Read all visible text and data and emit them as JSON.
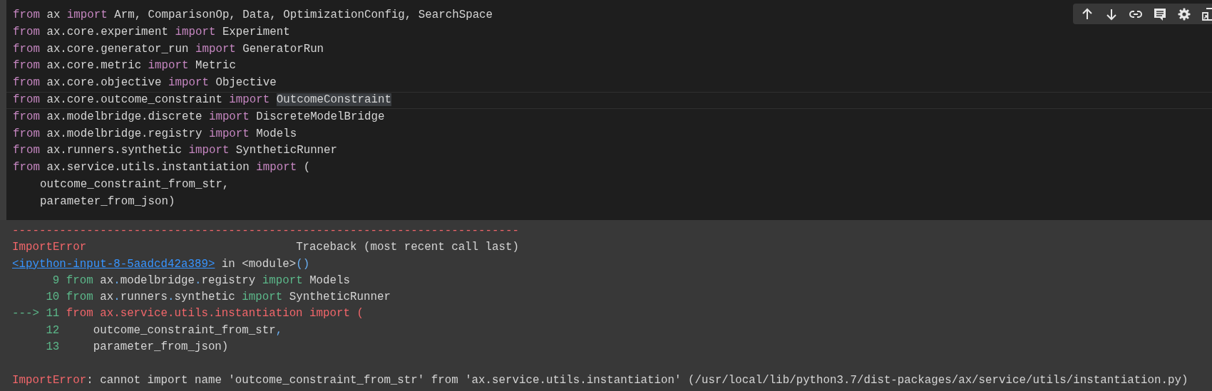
{
  "code_cell": {
    "lines": [
      {
        "current": false,
        "tokens": [
          {
            "kind": "kw",
            "text": "from"
          },
          {
            "kind": "plain",
            "text": " ax "
          },
          {
            "kind": "kw",
            "text": "import"
          },
          {
            "kind": "plain",
            "text": " Arm, ComparisonOp, Data, OptimizationConfig, SearchSpace"
          }
        ]
      },
      {
        "current": false,
        "tokens": [
          {
            "kind": "kw",
            "text": "from"
          },
          {
            "kind": "plain",
            "text": " ax.core.experiment "
          },
          {
            "kind": "kw",
            "text": "import"
          },
          {
            "kind": "plain",
            "text": " Experiment"
          }
        ]
      },
      {
        "current": false,
        "tokens": [
          {
            "kind": "kw",
            "text": "from"
          },
          {
            "kind": "plain",
            "text": " ax.core.generator_run "
          },
          {
            "kind": "kw",
            "text": "import"
          },
          {
            "kind": "plain",
            "text": " GeneratorRun"
          }
        ]
      },
      {
        "current": false,
        "tokens": [
          {
            "kind": "kw",
            "text": "from"
          },
          {
            "kind": "plain",
            "text": " ax.core.metric "
          },
          {
            "kind": "kw",
            "text": "import"
          },
          {
            "kind": "plain",
            "text": " Metric"
          }
        ]
      },
      {
        "current": false,
        "tokens": [
          {
            "kind": "kw",
            "text": "from"
          },
          {
            "kind": "plain",
            "text": " ax.core.objective "
          },
          {
            "kind": "kw",
            "text": "import"
          },
          {
            "kind": "plain",
            "text": " Objective"
          }
        ]
      },
      {
        "current": true,
        "tokens": [
          {
            "kind": "kw",
            "text": "from"
          },
          {
            "kind": "plain",
            "text": " ax.core.outcome_constraint "
          },
          {
            "kind": "kw",
            "text": "import"
          },
          {
            "kind": "match",
            "text": "OutcomeConstraint"
          }
        ]
      },
      {
        "current": false,
        "tokens": [
          {
            "kind": "kw",
            "text": "from"
          },
          {
            "kind": "plain",
            "text": " ax.modelbridge.discrete "
          },
          {
            "kind": "kw",
            "text": "import"
          },
          {
            "kind": "plain",
            "text": " DiscreteModelBridge"
          }
        ]
      },
      {
        "current": false,
        "tokens": [
          {
            "kind": "kw",
            "text": "from"
          },
          {
            "kind": "plain",
            "text": " ax.modelbridge.registry "
          },
          {
            "kind": "kw",
            "text": "import"
          },
          {
            "kind": "plain",
            "text": " Models"
          }
        ]
      },
      {
        "current": false,
        "tokens": [
          {
            "kind": "kw",
            "text": "from"
          },
          {
            "kind": "plain",
            "text": " ax.runners.synthetic "
          },
          {
            "kind": "kw",
            "text": "import"
          },
          {
            "kind": "plain",
            "text": " SyntheticRunner"
          }
        ]
      },
      {
        "current": false,
        "tokens": [
          {
            "kind": "kw",
            "text": "from"
          },
          {
            "kind": "plain",
            "text": " ax.service.utils.instantiation "
          },
          {
            "kind": "kw",
            "text": "import"
          },
          {
            "kind": "plain",
            "text": " ("
          }
        ]
      },
      {
        "current": false,
        "tokens": [
          {
            "kind": "plain",
            "text": "    outcome_constraint_from_str,"
          }
        ]
      },
      {
        "current": false,
        "tokens": [
          {
            "kind": "plain",
            "text": "    parameter_from_json)"
          }
        ]
      }
    ]
  },
  "output": {
    "separator": "---------------------------------------------------------------------------",
    "error_name": "ImportError",
    "traceback_title": "Traceback (most recent call last)",
    "location": [
      {
        "kind": "link",
        "text": "<ipython-input-8-5aadcd42a389>"
      },
      {
        "kind": "plain",
        "text": " in <module>"
      },
      {
        "kind": "punct",
        "text": "()"
      }
    ],
    "frames": [
      {
        "number": "9",
        "tokens": [
          {
            "kind": "kw",
            "text": "from"
          },
          {
            "kind": "plain",
            "text": " ax"
          },
          {
            "kind": "punct",
            "text": "."
          },
          {
            "kind": "plain",
            "text": "modelbridge"
          },
          {
            "kind": "punct",
            "text": "."
          },
          {
            "kind": "plain",
            "text": "registry "
          },
          {
            "kind": "kw",
            "text": "import"
          },
          {
            "kind": "plain",
            "text": " Models"
          }
        ]
      },
      {
        "number": "10",
        "tokens": [
          {
            "kind": "kw",
            "text": "from"
          },
          {
            "kind": "plain",
            "text": " ax"
          },
          {
            "kind": "punct",
            "text": "."
          },
          {
            "kind": "plain",
            "text": "runners"
          },
          {
            "kind": "punct",
            "text": "."
          },
          {
            "kind": "plain",
            "text": "synthetic "
          },
          {
            "kind": "kw",
            "text": "import"
          },
          {
            "kind": "plain",
            "text": " SyntheticRunner"
          }
        ]
      },
      {
        "arrow": "--->",
        "number": "11",
        "tokens": [
          {
            "kind": "err",
            "text": "from ax.service.utils.instantiation import ("
          }
        ]
      },
      {
        "number": "12",
        "tokens": [
          {
            "kind": "plain",
            "text": "    outcome_constraint_from_str"
          },
          {
            "kind": "punct",
            "text": ","
          }
        ]
      },
      {
        "number": "13",
        "tokens": [
          {
            "kind": "plain",
            "text": "    parameter_from_json)"
          }
        ]
      }
    ],
    "error": [
      {
        "kind": "err",
        "text": "ImportError"
      },
      {
        "kind": "plain",
        "text": ": cannot import name 'outcome_constraint_from_str' from 'ax.service.utils.instantiation' (/usr/local/lib/python3.7/dist-packages/ax/service/utils/instantiation.py)"
      }
    ]
  }
}
